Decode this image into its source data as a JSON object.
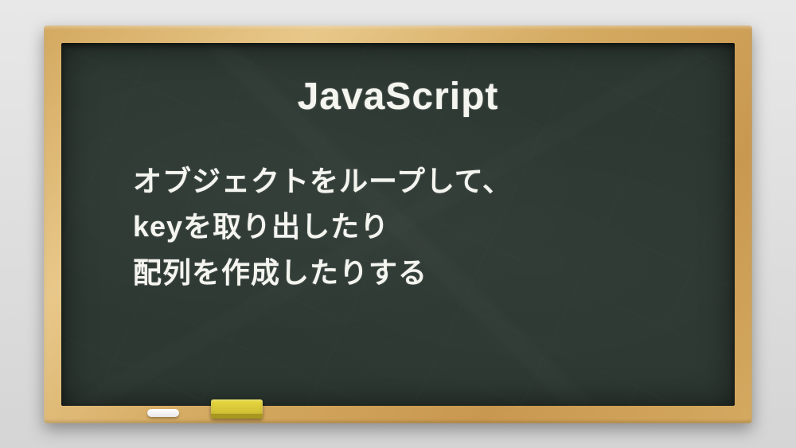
{
  "board": {
    "title": "JavaScript",
    "line1": "オブジェクトをループして、",
    "line2": "keyを取り出したり",
    "line3": "配列を作成したりする"
  }
}
